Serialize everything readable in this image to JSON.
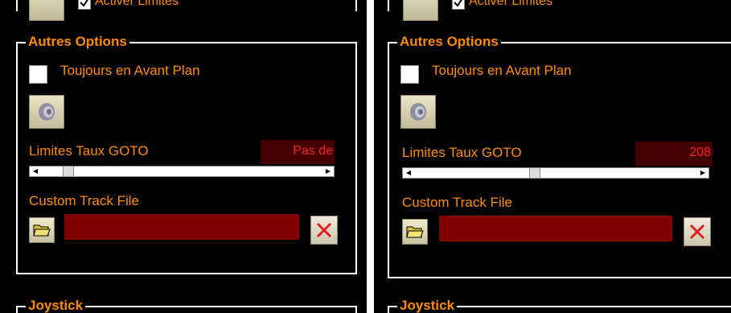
{
  "panels": [
    {
      "top_checkbox_label": "Activer Limites",
      "top_checkbox_checked": true,
      "group_title": "Autres Options",
      "always_on_top_label": "Toujours en Avant Plan",
      "always_on_top_checked": false,
      "goto_label": "Limites Taux GOTO",
      "goto_value": "Pas de",
      "goto_slider_position": 0.08,
      "custom_track_label": "Custom Track File",
      "custom_track_value": "",
      "joystick_title": "Joystick"
    },
    {
      "top_checkbox_label": "Activer Limites",
      "top_checkbox_checked": true,
      "group_title": "Autres Options",
      "always_on_top_label": "Toujours en Avant Plan",
      "always_on_top_checked": false,
      "goto_label": "Limites Taux GOTO",
      "goto_value": "208",
      "goto_slider_position": 0.42,
      "custom_track_label": "Custom Track File",
      "custom_track_value": "",
      "joystick_title": "Joystick"
    }
  ],
  "icons": {
    "sound": "speaker-icon",
    "folder": "folder-open-icon",
    "clear": "red-x-icon"
  },
  "colors": {
    "background": "#000000",
    "label": "#ff8c00",
    "value_text": "#ff2020",
    "value_box": "#420000",
    "file_field": "#800000",
    "frame": "#ffffff"
  }
}
